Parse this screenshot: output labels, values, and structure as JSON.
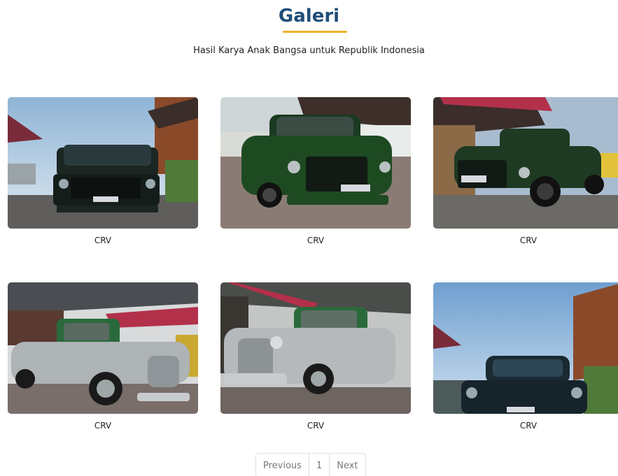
{
  "gallery": {
    "title": "Galeri",
    "subtitle": "Hasil Karya Anak Bangsa untuk Republik Indonesia",
    "accent_color": "#f0b429",
    "title_color": "#1f4e79",
    "items": [
      {
        "caption": "CRV",
        "truck_color": "#1b2622"
      },
      {
        "caption": "CRV",
        "truck_color": "#1e4a22"
      },
      {
        "caption": "CRV",
        "truck_color": "#1f3a23"
      },
      {
        "caption": "CRV",
        "truck_color": "#aeb3b6"
      },
      {
        "caption": "CRV",
        "truck_color": "#b5b9bb"
      },
      {
        "caption": "CRV",
        "truck_color": "#1a2a33"
      }
    ]
  },
  "pagination": {
    "previous": "Previous",
    "page": "1",
    "next": "Next"
  }
}
